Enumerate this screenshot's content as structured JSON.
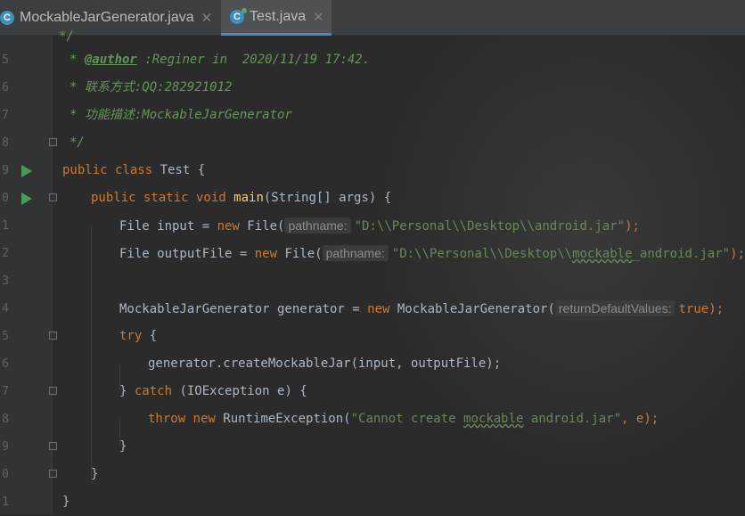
{
  "tabs": [
    {
      "label": "MockableJarGenerator.java",
      "icon": "java-class-icon",
      "active": false
    },
    {
      "label": "Test.java",
      "icon": "java-class-icon",
      "active": true
    }
  ],
  "lines": {
    "l4": {
      "num": "",
      "code": "*/"
    },
    "l5": {
      "num": "5",
      "star": "* ",
      "tag": "@author",
      "rest": " :Reginer in  2020/11/19 17:42."
    },
    "l6": {
      "num": "6",
      "text": "* 联系方式:QQ:282921012"
    },
    "l7": {
      "num": "7",
      "text": "* 功能描述:MockableJarGenerator"
    },
    "l8": {
      "num": "8",
      "text": "*/"
    },
    "l9": {
      "num": "9",
      "kw": "public class ",
      "name": "Test {"
    },
    "l10": {
      "num": "0",
      "kw": "public static void ",
      "fn": "main",
      "rest": "(String[] args) {"
    },
    "l11": {
      "num": "1",
      "pre": "File input = ",
      "kw": "new ",
      "cls": "File(",
      "hint": "pathname:",
      "str": "\"D:\\\\Personal\\\\Desktop\\\\android.jar\"",
      "post": ");"
    },
    "l12": {
      "num": "2",
      "pre": "File outputFile = ",
      "kw": "new ",
      "cls": "File(",
      "hint": "pathname:",
      "str1": "\"D:\\\\Personal\\\\Desktop\\\\",
      "str2": "mockable",
      "str3": "_android.jar\"",
      "post": ");"
    },
    "l13": {
      "num": "3"
    },
    "l14": {
      "num": "4",
      "pre": "MockableJarGenerator generator = ",
      "kw": "new ",
      "cls": "MockableJarGenerator(",
      "hint": "returnDefaultValues:",
      "val": "true",
      "post": ");"
    },
    "l15": {
      "num": "5",
      "kw": "try",
      "rest": " {"
    },
    "l16": {
      "num": "6",
      "text": "generator.createMockableJar(input, outputFile);"
    },
    "l17": {
      "num": "7",
      "pre": "} ",
      "kw": "catch",
      "rest": " (IOException e) {"
    },
    "l18": {
      "num": "8",
      "kw1": "throw ",
      "kw2": "new ",
      "cls": "RuntimeException(",
      "str1": "\"Cannot create ",
      "str2": "mockable",
      "str3": " android.jar\"",
      "post": ", e);"
    },
    "l19": {
      "num": "9",
      "text": "}"
    },
    "l20": {
      "num": "0",
      "text": "}"
    },
    "l21": {
      "num": "1",
      "text": "}"
    }
  },
  "colors": {
    "keyword": "#cc7832",
    "string": "#6a8759",
    "comment": "#629755",
    "function": "#ffc66d",
    "background": "#2b2b2b"
  }
}
